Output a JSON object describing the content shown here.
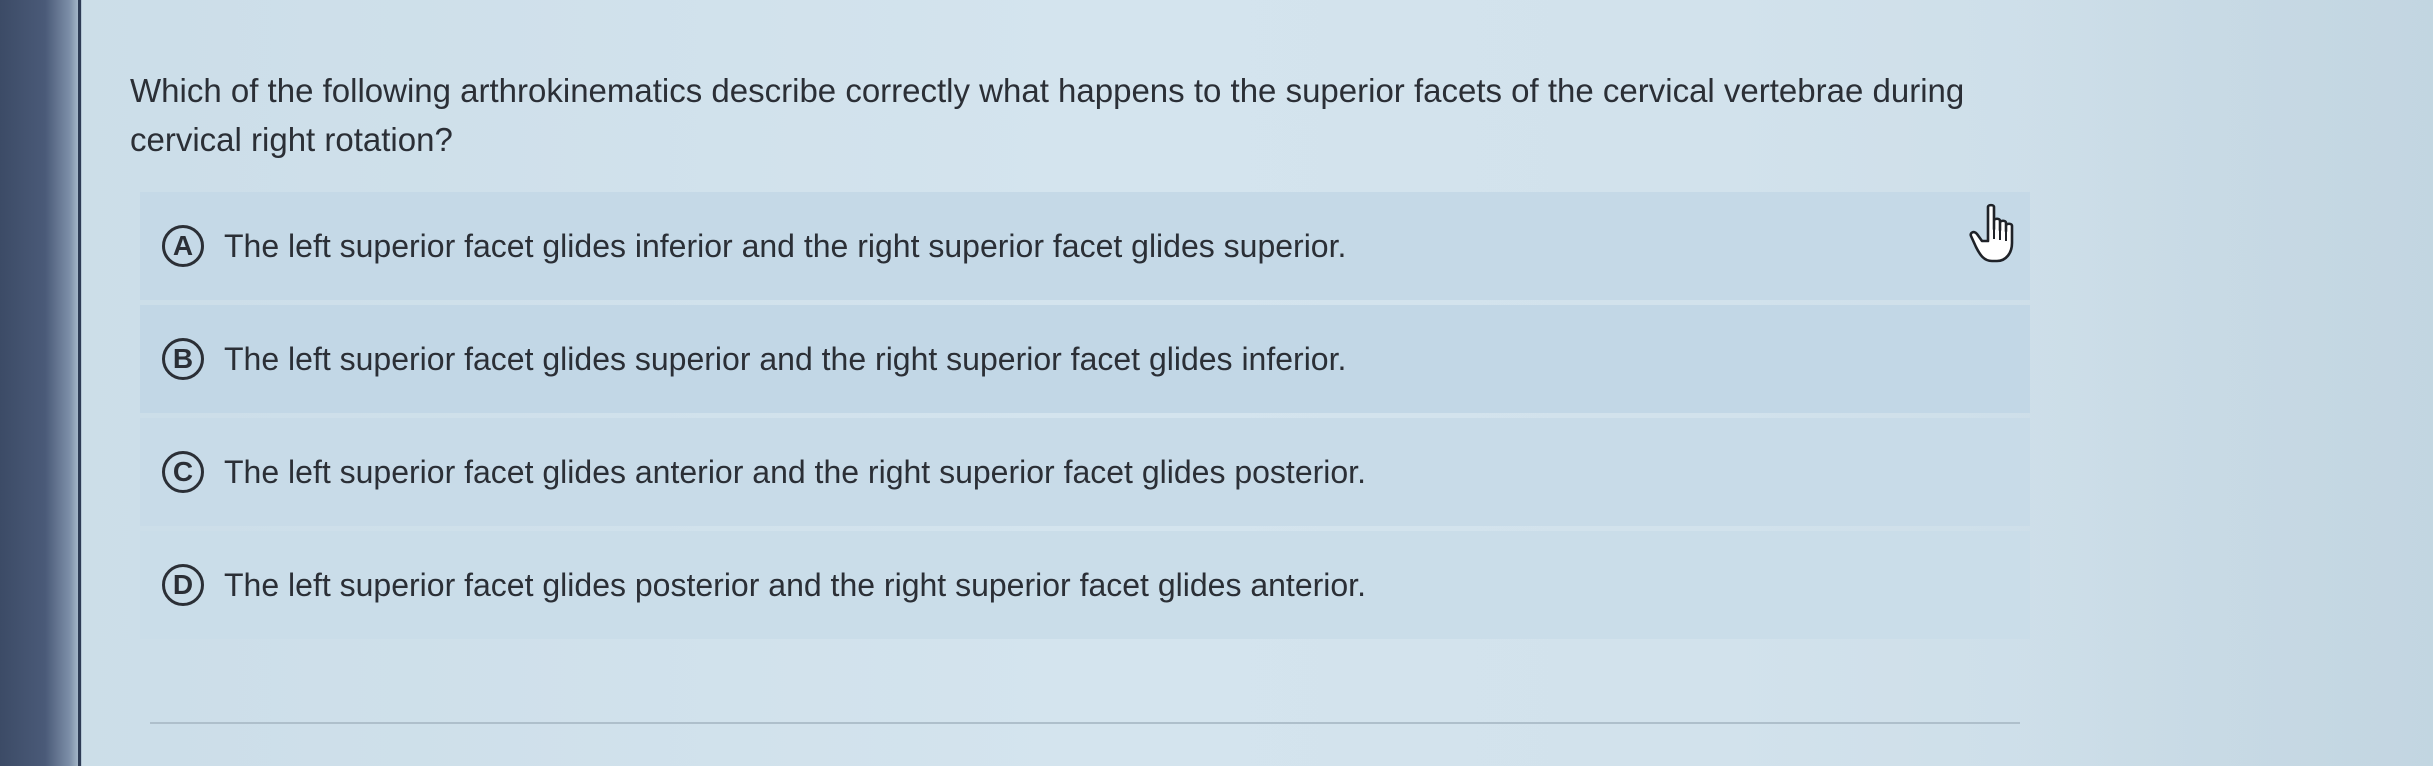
{
  "question": {
    "text": "Which of the following arthrokinematics describe correctly what happens to the superior facets of the cervical vertebrae during cervical right rotation?"
  },
  "options": [
    {
      "letter": "A",
      "text": "The left superior facet glides inferior and the right superior facet glides superior."
    },
    {
      "letter": "B",
      "text": "The left superior facet glides superior and the right superior facet glides inferior."
    },
    {
      "letter": "C",
      "text": "The left superior facet glides anterior and the right superior facet glides posterior."
    },
    {
      "letter": "D",
      "text": "The left superior facet glides posterior and the right superior facet glides anterior."
    }
  ],
  "cursor": {
    "icon": "hand-pointer-icon"
  }
}
